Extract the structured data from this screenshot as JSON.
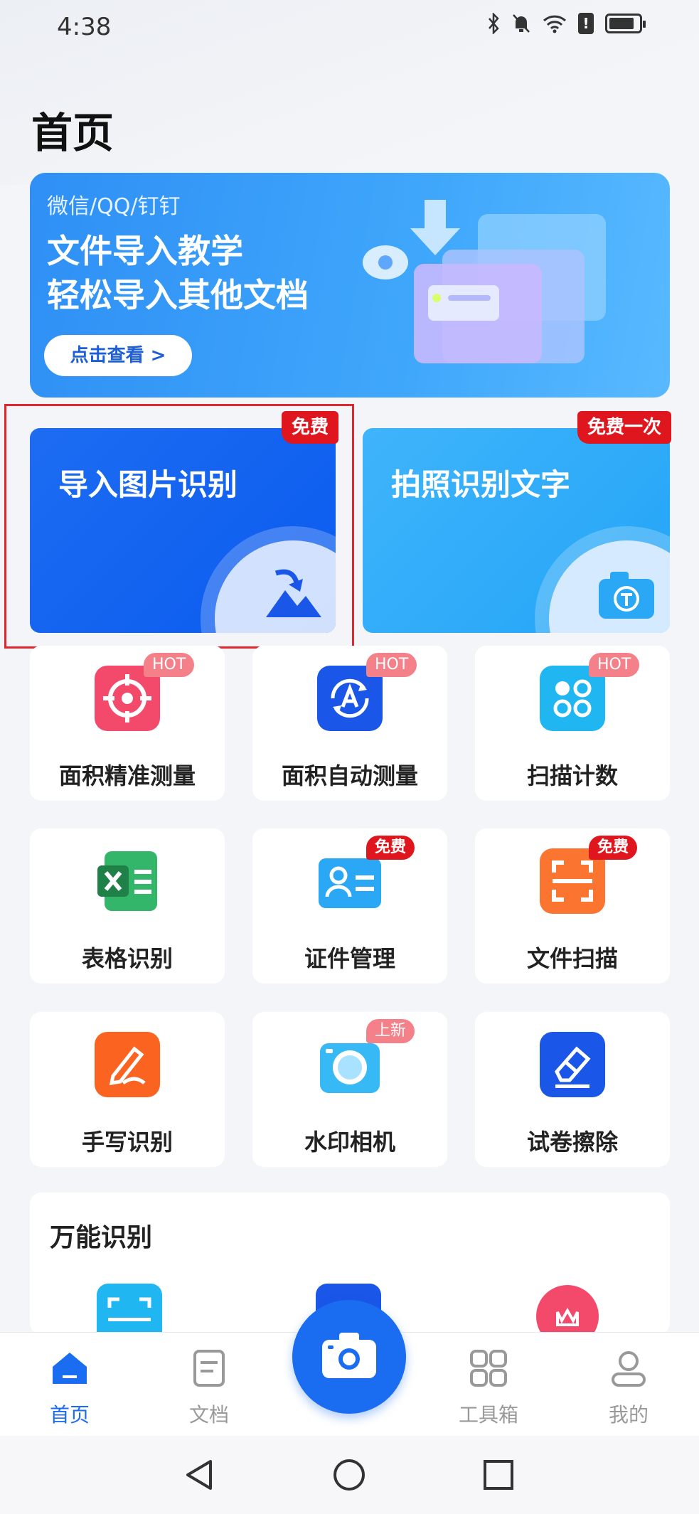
{
  "status_bar": {
    "time": "4:38",
    "alert": "!"
  },
  "page_title": "首页",
  "banner": {
    "subtitle": "微信/QQ/钉钉",
    "line1": "文件导入教学",
    "line2": "轻松导入其他文档",
    "button": "点击查看 >"
  },
  "feature_cards": [
    {
      "title": "导入图片识别",
      "tag": "免费",
      "icon": "image-import-icon"
    },
    {
      "title": "拍照识别文字",
      "tag": "免费一次",
      "icon": "camera-text-icon"
    }
  ],
  "tools": [
    {
      "label": "面积精准测量",
      "badge": "HOT",
      "icon": "target-icon",
      "color": "#f3496a"
    },
    {
      "label": "面积自动测量",
      "badge": "HOT",
      "icon": "auto-measure-icon",
      "color": "#1a56e8"
    },
    {
      "label": "扫描计数",
      "badge": "HOT",
      "icon": "dots-count-icon",
      "color": "#1fb6f2"
    },
    {
      "label": "表格识别",
      "badge": "",
      "icon": "excel-icon",
      "color": "#27a55a"
    },
    {
      "label": "证件管理",
      "badge": "免费",
      "icon": "id-card-icon",
      "color": "#2aa7f5"
    },
    {
      "label": "文件扫描",
      "badge": "免费",
      "icon": "scan-frame-icon",
      "color": "#fb7430"
    },
    {
      "label": "手写识别",
      "badge": "",
      "icon": "handwriting-icon",
      "color": "#fb6320"
    },
    {
      "label": "水印相机",
      "badge": "上新",
      "icon": "watermark-camera-icon",
      "color": "#36b9f5"
    },
    {
      "label": "试卷擦除",
      "badge": "",
      "icon": "eraser-icon",
      "color": "#1a56e8"
    }
  ],
  "universal": {
    "title": "万能识别"
  },
  "bottom_nav": [
    {
      "label": "首页",
      "icon": "home-icon"
    },
    {
      "label": "文档",
      "icon": "document-icon"
    },
    {
      "label": "工具箱",
      "icon": "toolbox-icon"
    },
    {
      "label": "我的",
      "icon": "profile-icon"
    }
  ],
  "colors": {
    "primary": "#1a6cf1",
    "tag_red": "#e0161f",
    "highlight": "#e0272e"
  }
}
